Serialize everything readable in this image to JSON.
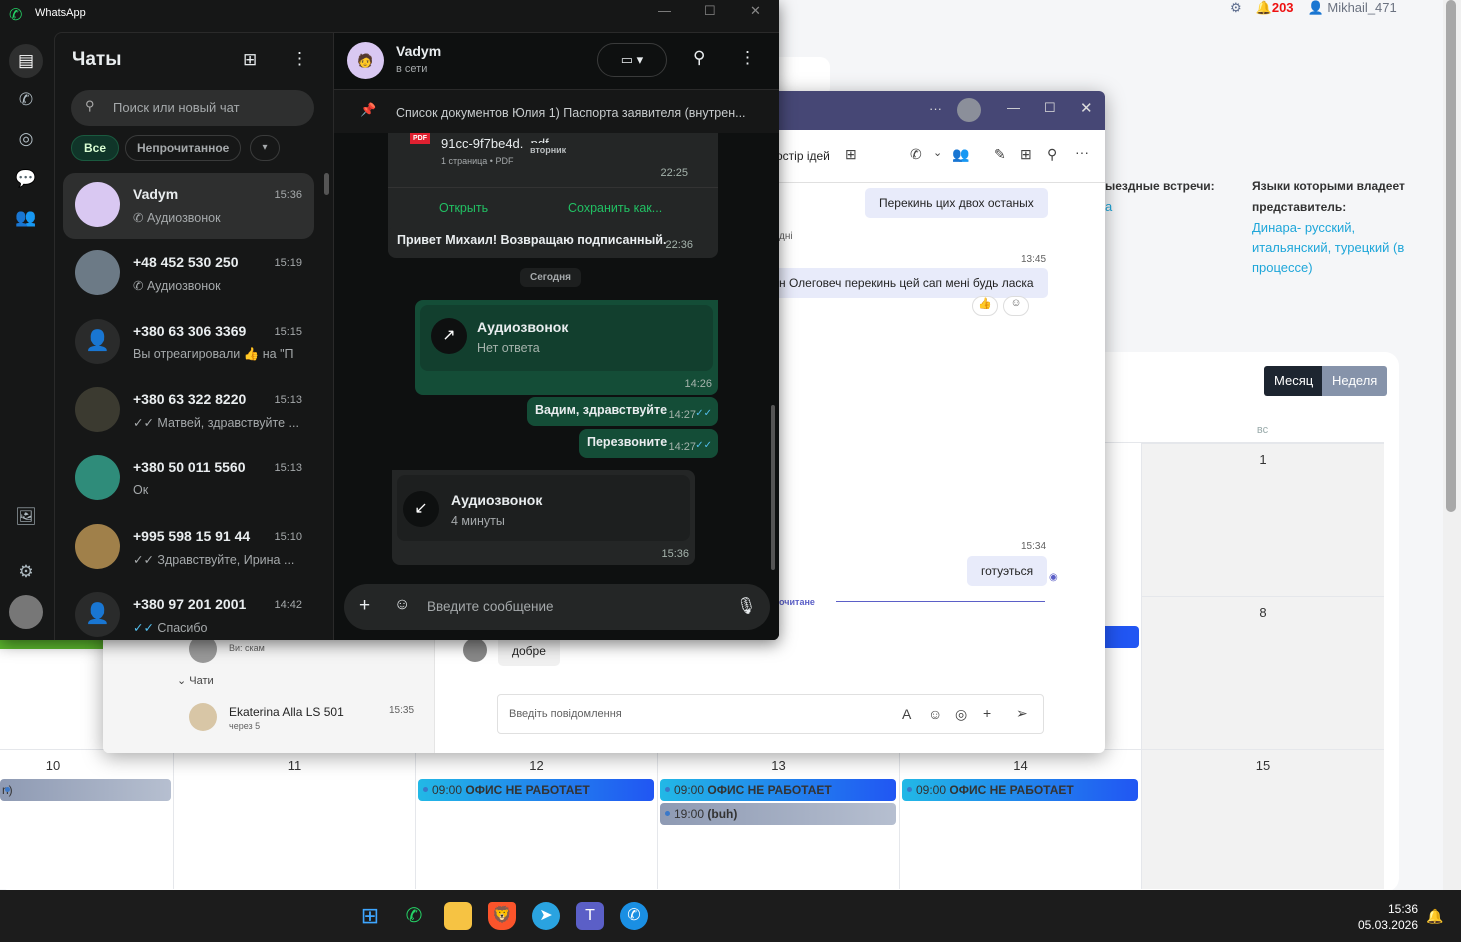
{
  "web": {
    "settings_icon": "gear-icon",
    "notifications_count": "203",
    "username": "Mikhail_471",
    "info_partial_heading": "ыездные встречи:",
    "info_partial_value": "а",
    "languages_heading_1": "Языки которыми владеет",
    "languages_heading_2": "представитель:",
    "languages_value_1": "Динара- русский,",
    "languages_value_2": "итальянский, турецкий (в",
    "languages_value_3": "процессе)",
    "view_month": "Месяц",
    "view_week": "Неделя",
    "dow_sun": "вс",
    "days": [
      "10",
      "11",
      "12",
      "13",
      "14",
      "15"
    ],
    "day_1": "1",
    "day_8": "8",
    "events": [
      {
        "time": "09:00",
        "title": "ОФИС НЕ РАБОТАЕТ"
      },
      {
        "time": "09:00",
        "title": "ОФИС НЕ РАБОТАЕТ"
      },
      {
        "time": "19:00",
        "title": "(buh)"
      },
      {
        "time": "09:00",
        "title": "ОФИС НЕ РАБОТАЕТ"
      }
    ],
    "partial_event": "n)"
  },
  "teams": {
    "tab_partial": "остір ідей",
    "messages": [
      {
        "text": "Перекинь цих двох останых"
      },
      {
        "text": "н Олеговеч перекинь цей сап мені будь ласка",
        "time": "13:45"
      },
      {
        "text": "готуэться",
        "time": "15:34"
      }
    ],
    "partial_day": "дні",
    "unread_label": "очитане",
    "other_msg": "добре",
    "list_last_preview": "Ви: скам",
    "chats_section": "Чати",
    "chat_item": {
      "name": "Ekaterina Alla LS 501",
      "time": "15:35",
      "preview": "через 5"
    },
    "compose_placeholder": "Введіть повідомлення"
  },
  "whatsapp": {
    "app_title": "WhatsApp",
    "chats_title": "Чаты",
    "search_placeholder": "Поиск или новый чат",
    "filters": [
      "Все",
      "Непрочитанное"
    ],
    "chats": [
      {
        "name": "Vadym",
        "time": "15:36",
        "preview": "Аудиозвонок",
        "selected": true
      },
      {
        "name": "+48 452 530 250",
        "time": "15:19",
        "preview": "Аудиозвонок"
      },
      {
        "name": "+380 63 306 3369",
        "time": "15:15",
        "preview": "Вы отреагировали 👍 на \"П"
      },
      {
        "name": "+380 63 322 8220",
        "time": "15:13",
        "preview": "Матвей, здравствуйте ..."
      },
      {
        "name": "+380 50 011 5560",
        "time": "15:13",
        "preview": "Ок"
      },
      {
        "name": "+995 598 15 91 44",
        "time": "15:10",
        "preview": "Здравствуйте, Ирина ..."
      },
      {
        "name": "+380 97 201 2001",
        "time": "14:42",
        "preview": "Спасибо"
      }
    ],
    "contact": {
      "name": "Vadym",
      "status": "в сети"
    },
    "pinned": "Список документов Юлия 1) Паспорта заявителя (внутрен...",
    "doc": {
      "badge": "PDF",
      "name": "91cc-9f7be4d...pdf",
      "meta": "1 страница • PDF",
      "time": "22:25",
      "open": "Открыть",
      "save": "Сохранить как..."
    },
    "day_tooltip": "вторник",
    "msg_in_1": {
      "text": "Привет Михаил! Возвращаю подписанный.",
      "time": "22:36"
    },
    "today": "Сегодня",
    "call_out": {
      "title": "Аудиозвонок",
      "sub": "Нет ответа",
      "time": "14:26"
    },
    "msg_out_1": {
      "text": "Вадим, здравствуйте",
      "time": "14:27"
    },
    "msg_out_2": {
      "text": "Перезвоните",
      "time": "14:27"
    },
    "call_in": {
      "title": "Аудиозвонок",
      "sub": "4 минуты",
      "time": "15:36"
    },
    "compose_placeholder": "Введите сообщение"
  },
  "taskbar": {
    "time": "15:36",
    "date": "05.03.2026"
  }
}
